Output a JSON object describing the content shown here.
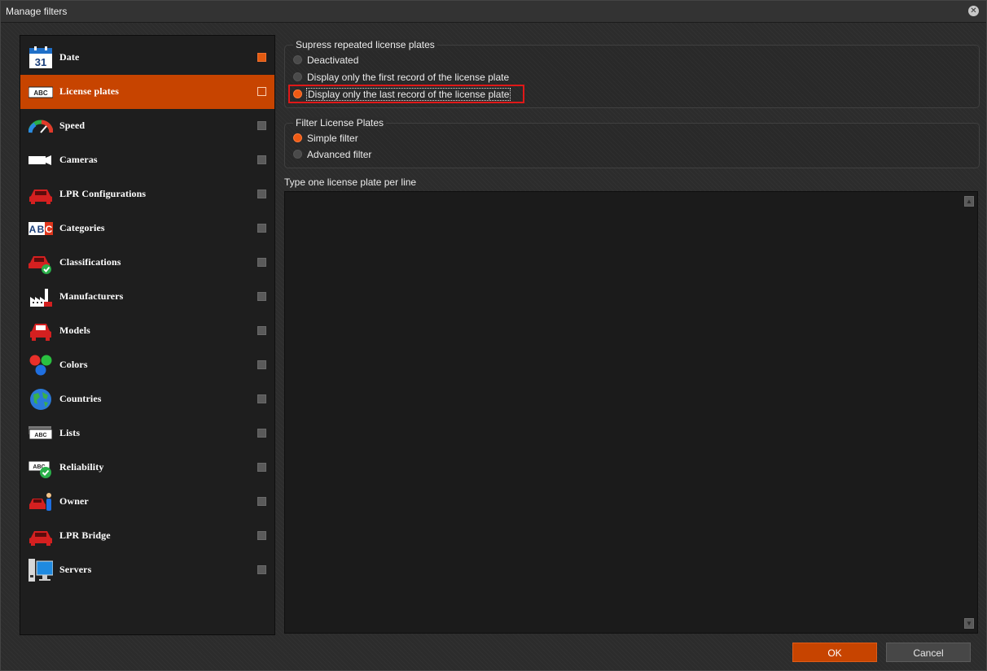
{
  "window": {
    "title": "Manage filters"
  },
  "sidebar": {
    "items": [
      {
        "label": "Date",
        "icon": "calendar-icon",
        "checked": true,
        "selected": false
      },
      {
        "label": "License plates",
        "icon": "license-plate-icon",
        "checked": false,
        "selected": true
      },
      {
        "label": "Speed",
        "icon": "speedometer-icon",
        "checked": false,
        "selected": false
      },
      {
        "label": "Cameras",
        "icon": "camera-icon",
        "checked": false,
        "selected": false
      },
      {
        "label": "LPR Configurations",
        "icon": "car-icon",
        "checked": false,
        "selected": false
      },
      {
        "label": "Categories",
        "icon": "abc-icon",
        "checked": false,
        "selected": false
      },
      {
        "label": "Classifications",
        "icon": "car-check-icon",
        "checked": false,
        "selected": false
      },
      {
        "label": "Manufacturers",
        "icon": "factory-icon",
        "checked": false,
        "selected": false
      },
      {
        "label": "Models",
        "icon": "car-front-icon",
        "checked": false,
        "selected": false
      },
      {
        "label": "Colors",
        "icon": "color-dots-icon",
        "checked": false,
        "selected": false
      },
      {
        "label": "Countries",
        "icon": "globe-icon",
        "checked": false,
        "selected": false
      },
      {
        "label": "Lists",
        "icon": "list-plates-icon",
        "checked": false,
        "selected": false
      },
      {
        "label": "Reliability",
        "icon": "plate-check-icon",
        "checked": false,
        "selected": false
      },
      {
        "label": "Owner",
        "icon": "car-person-icon",
        "checked": false,
        "selected": false
      },
      {
        "label": "LPR Bridge",
        "icon": "car-icon",
        "checked": false,
        "selected": false
      },
      {
        "label": "Servers",
        "icon": "computer-icon",
        "checked": false,
        "selected": false
      }
    ]
  },
  "suppress_group": {
    "title": "Supress repeated license plates",
    "options": [
      {
        "label": "Deactivated",
        "selected": false
      },
      {
        "label": "Display only the first record of the license plate",
        "selected": false
      },
      {
        "label": "Display only the last record of the license plate",
        "selected": true
      }
    ]
  },
  "filter_group": {
    "title": "Filter License Plates",
    "options": [
      {
        "label": "Simple filter",
        "selected": true
      },
      {
        "label": "Advanced filter",
        "selected": false
      }
    ]
  },
  "plates_input": {
    "label": "Type one license plate per line",
    "value": ""
  },
  "footer": {
    "ok_label": "OK",
    "cancel_label": "Cancel"
  },
  "colors": {
    "accent": "#c74400",
    "background": "#2c2c2c",
    "highlight": "#e01818"
  }
}
